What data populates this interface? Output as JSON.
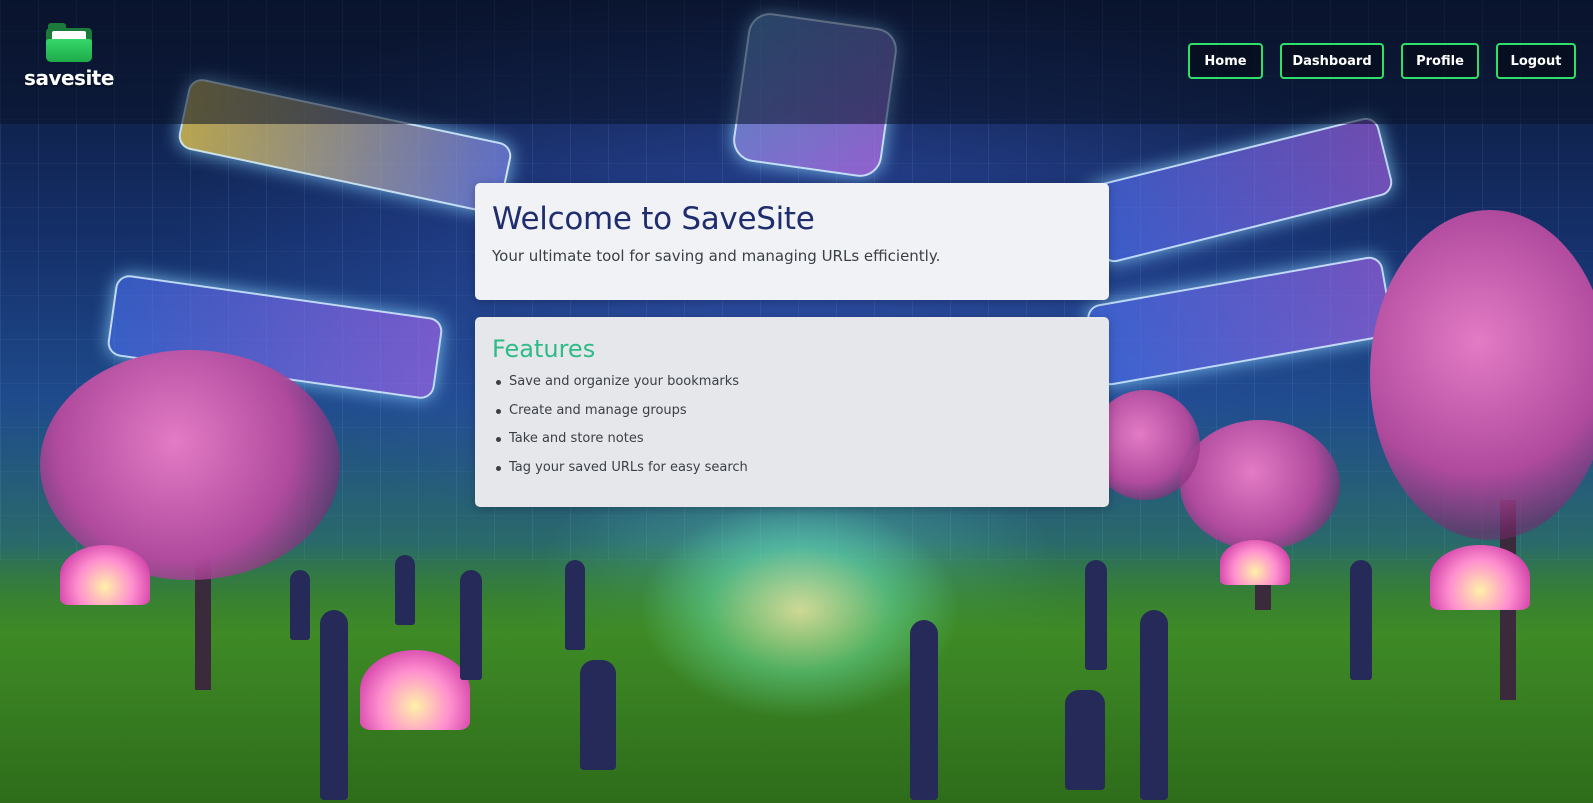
{
  "brand": {
    "logo_text": "savesite",
    "logo_icon": "folder-icon"
  },
  "nav": {
    "items": [
      {
        "label": "Home"
      },
      {
        "label": "Dashboard"
      },
      {
        "label": "Profile"
      },
      {
        "label": "Logout"
      }
    ],
    "border_color": "#2ee06a"
  },
  "welcome": {
    "title": "Welcome to SaveSite",
    "subtitle": "Your ultimate tool for saving and managing URLs efficiently."
  },
  "features": {
    "heading": "Features",
    "items": [
      "Save and organize your bookmarks",
      "Create and manage groups",
      "Take and store notes",
      "Tag your saved URLs for easy search"
    ]
  },
  "colors": {
    "title": "#1f2d6e",
    "features_heading": "#2dbb86",
    "card_bg": "#f1f2f5"
  }
}
